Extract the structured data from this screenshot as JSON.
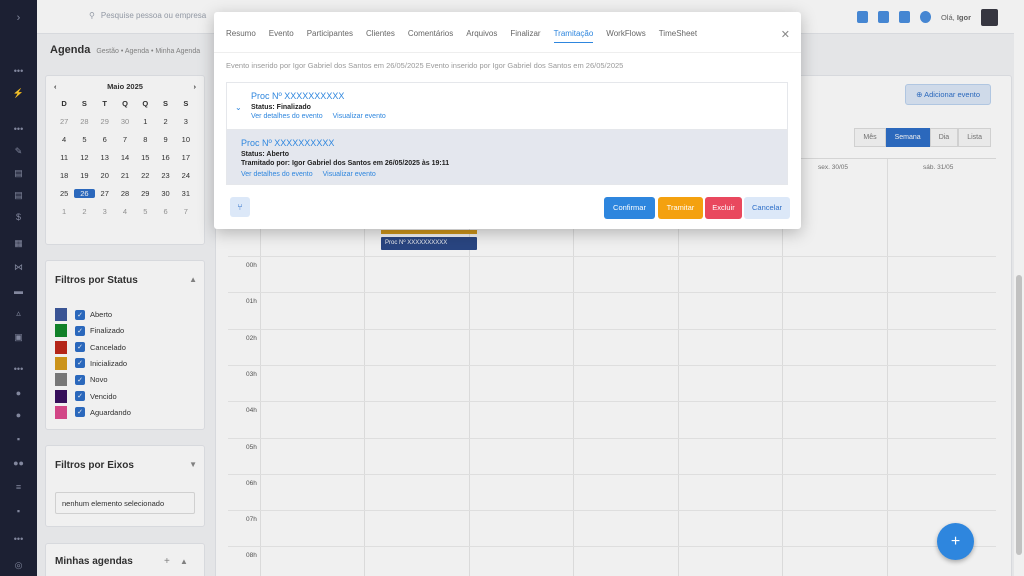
{
  "topbar": {
    "search_placeholder": "Pesquise pessoa ou empresa",
    "greeting": "Olá,",
    "user": "Igor"
  },
  "breadcrumb": {
    "title": "Agenda",
    "path": "Gestão • Agenda • Minha Agenda"
  },
  "calendar": {
    "month_label": "Maio 2025",
    "day_names": [
      "D",
      "S",
      "T",
      "Q",
      "Q",
      "S",
      "S"
    ],
    "days": [
      [
        "27",
        "28",
        "29",
        "30",
        "1",
        "2",
        "3"
      ],
      [
        "4",
        "5",
        "6",
        "7",
        "8",
        "9",
        "10"
      ],
      [
        "11",
        "12",
        "13",
        "14",
        "15",
        "16",
        "17"
      ],
      [
        "18",
        "19",
        "20",
        "21",
        "22",
        "23",
        "24"
      ],
      [
        "25",
        "26",
        "27",
        "28",
        "29",
        "30",
        "31"
      ],
      [
        "1",
        "2",
        "3",
        "4",
        "5",
        "6",
        "7"
      ]
    ],
    "selected": "26"
  },
  "status_filter": {
    "title": "Filtros por Status",
    "items": [
      {
        "label": "Aberto",
        "color": "#3e5a9e"
      },
      {
        "label": "Finalizado",
        "color": "#138a2c"
      },
      {
        "label": "Cancelado",
        "color": "#c0291b"
      },
      {
        "label": "Inicializado",
        "color": "#d89d1c"
      },
      {
        "label": "Novo",
        "color": "#7f7f7f"
      },
      {
        "label": "Vencido",
        "color": "#3a1060"
      },
      {
        "label": "Aguardando",
        "color": "#e04b8f"
      }
    ]
  },
  "axis_filter": {
    "title": "Filtros por Eixos",
    "placeholder": "nenhum elemento selecionado"
  },
  "my_agendas": {
    "title": "Minhas agendas"
  },
  "main": {
    "add_event": "Adicionar evento",
    "views": [
      "Mês",
      "Semana",
      "Dia",
      "Lista"
    ],
    "active_view": "Semana",
    "day_headers": [
      "sex. 30/05",
      "sáb. 31/05"
    ],
    "hours": [
      "00h",
      "01h",
      "02h",
      "03h",
      "04h",
      "05h",
      "06h",
      "07h",
      "08h"
    ],
    "event_label": "Proc Nº XXXXXXXXXX"
  },
  "modal": {
    "tabs": [
      "Resumo",
      "Evento",
      "Participantes",
      "Clientes",
      "Comentários",
      "Arquivos",
      "Finalizar",
      "Tramitação",
      "WorkFlows",
      "TimeSheet"
    ],
    "active_tab": "Tramitação",
    "info": "Evento inserido por Igor Gabriel dos Santos em 26/05/2025 Evento inserido por Igor Gabriel dos Santos em 26/05/2025",
    "procs": [
      {
        "title": "Proc Nº XXXXXXXXXX",
        "status": "Status: Finalizado",
        "tramitado": "",
        "link1": "Ver detalhes do evento",
        "link2": "Visualizar evento"
      },
      {
        "title": "Proc Nº XXXXXXXXXX",
        "status": "Status: Aberto",
        "tramitado": "Tramitado por: Igor Gabriel dos Santos em 26/05/2025 às 19:11",
        "link1": "Ver detalhes do evento",
        "link2": "Visualizar evento"
      }
    ],
    "buttons": {
      "confirm": "Confirmar",
      "tramitar": "Tramitar",
      "excluir": "Excluir",
      "cancelar": "Cancelar"
    }
  }
}
